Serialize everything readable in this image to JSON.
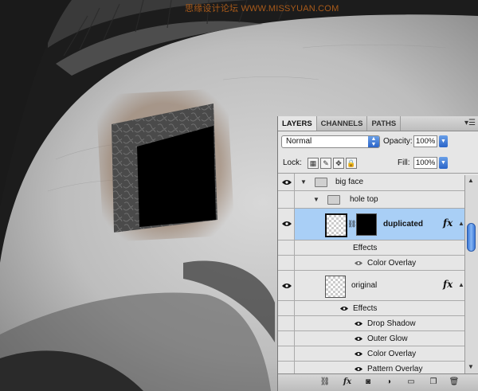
{
  "watermark": "思缘设计论坛 WWW.MISSYUAN.COM",
  "panel": {
    "tabs": [
      "LAYERS",
      "CHANNELS",
      "PATHS"
    ],
    "blend_mode": "Normal",
    "opacity_label": "Opacity:",
    "opacity_value": "100%",
    "lock_label": "Lock:",
    "fill_label": "Fill:",
    "fill_value": "100%"
  },
  "layers": [
    {
      "name": "big face",
      "kind": "group"
    },
    {
      "name": "hole top",
      "kind": "group"
    },
    {
      "name": "duplicated",
      "kind": "layer",
      "selected": true,
      "effects_label": "Effects",
      "effects": [
        "Color Overlay"
      ]
    },
    {
      "name": "original",
      "kind": "layer",
      "effects_label": "Effects",
      "effects": [
        "Drop Shadow",
        "Outer Glow",
        "Color Overlay",
        "Pattern Overlay"
      ]
    }
  ],
  "colors": {
    "selection": "#a9cff6",
    "accent_blue": "#2a64c8",
    "panel_bg": "#e6e6e6"
  },
  "icons": {
    "visibility": "eye-icon",
    "group": "folder-icon",
    "effects": "fx-icon"
  }
}
